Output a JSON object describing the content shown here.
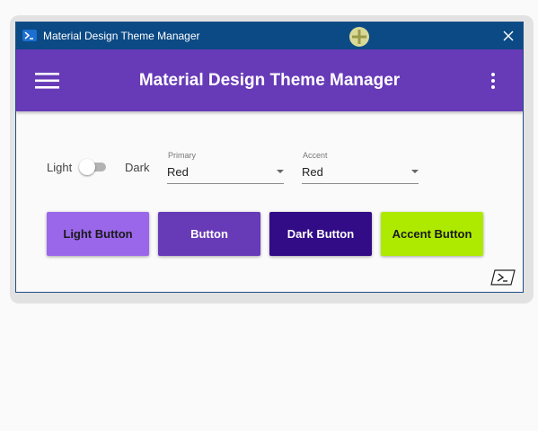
{
  "window": {
    "title": "Material Design Theme Manager"
  },
  "appbar": {
    "title": "Material Design Theme Manager"
  },
  "theme_toggle": {
    "left_label": "Light",
    "right_label": "Dark",
    "state": "Light"
  },
  "primary": {
    "hint": "Primary",
    "value": "Red"
  },
  "accent": {
    "hint": "Accent",
    "value": "Red"
  },
  "buttons": {
    "light": "Light Button",
    "mid": "Button",
    "dark": "Dark Button",
    "accent": "Accent Button"
  },
  "icons": {
    "titlebar": "powershell-icon",
    "close": "close-icon",
    "menu": "hamburger-menu-icon",
    "more": "more-vertical-icon",
    "cursor": "cursor-highlight-icon",
    "corner": "powershell-prompt-icon"
  },
  "colors": {
    "titlebar": "#0b4a85",
    "primary": "#673ab7",
    "primary_light": "#9a67ea",
    "primary_dark": "#320b86",
    "accent": "#aeea00"
  }
}
